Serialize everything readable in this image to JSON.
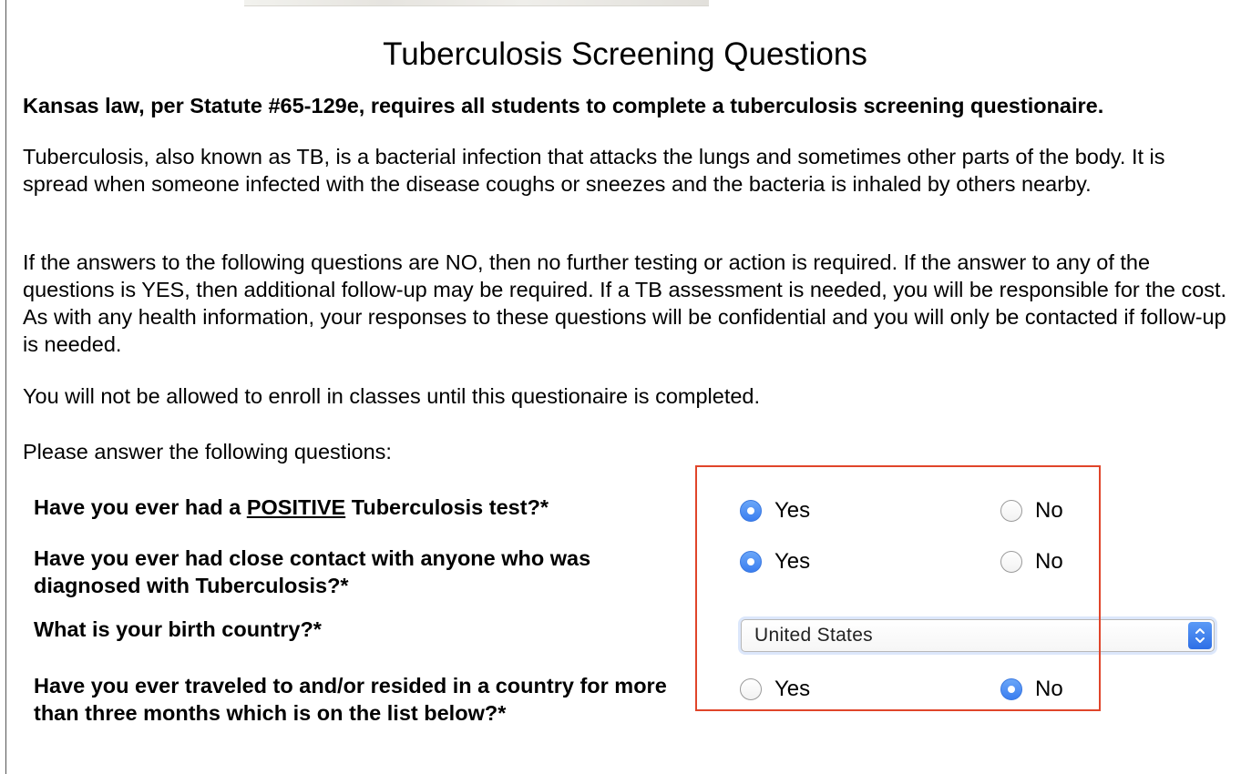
{
  "title": "Tuberculosis Screening Questions",
  "law_notice": "Kansas law, per Statute #65-129e, requires all students to complete a tuberculosis screening questionaire.",
  "intro_paragraphs": [
    "Tuberculosis, also known as TB, is a bacterial infection that attacks the lungs and sometimes other parts of the body. It is spread when someone infected with the disease coughs or sneezes and the bacteria is inhaled by others nearby.",
    "If the answers to the following questions are NO, then no further testing or action is required. If the answer to any of the questions is YES, then additional follow-up may be required. If a TB assessment is needed, you will be responsible for the cost. As with any health information, your responses to these questions will be confidential and you will only be contacted if follow-up is needed.",
    "You will not be allowed to enroll in classes until this questionaire is completed."
  ],
  "prompt": "Please answer the following questions:",
  "questions": [
    {
      "label_pre": "Have you ever had a ",
      "label_emphasis": "POSITIVE",
      "label_post": " Tuberculosis test?*",
      "options": [
        "Yes",
        "No"
      ],
      "selected": "Yes"
    },
    {
      "label": "Have you ever had close contact with anyone who was diagnosed with Tuberculosis?*",
      "options": [
        "Yes",
        "No"
      ],
      "selected": "Yes"
    },
    {
      "label": "What is your birth country?*",
      "select_value": "United States"
    },
    {
      "label": "Have you ever traveled to and/or resided in a country for more than three months which is on the list below?*",
      "options": [
        "Yes",
        "No"
      ],
      "selected": "No"
    }
  ],
  "colors": {
    "radio_selected": "#3b7ef0",
    "highlight_border": "#e0452a",
    "select_focus": "#dce7fb"
  }
}
